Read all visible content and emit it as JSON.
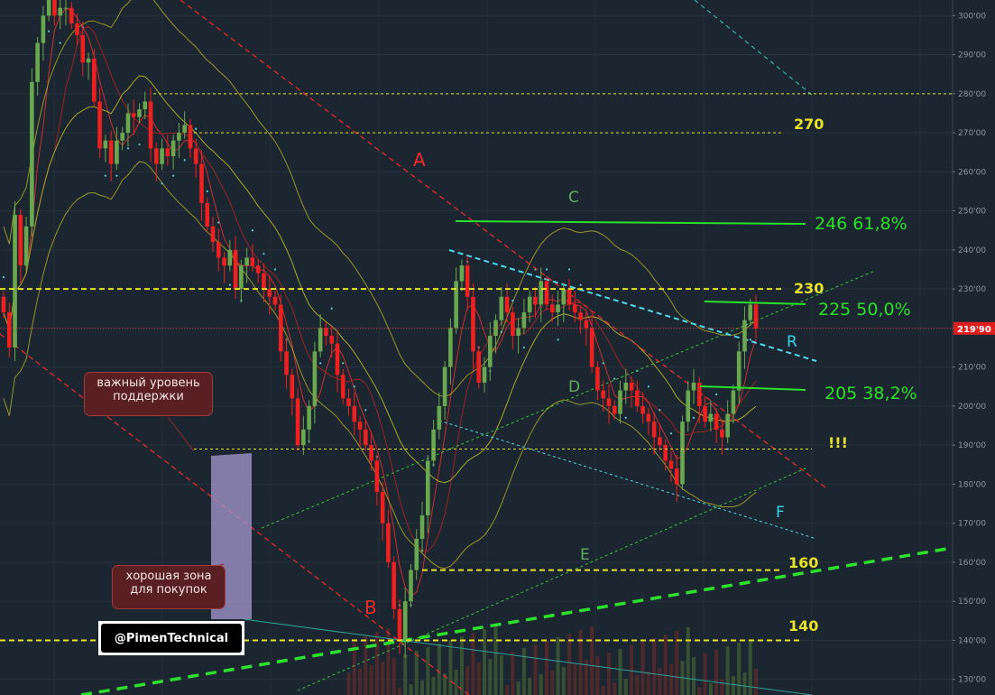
{
  "chart_data": {
    "type": "candlestick",
    "ylim": [
      126,
      304
    ],
    "y_ticks": [
      "130'00",
      "140'00",
      "150'00",
      "160'00",
      "170'00",
      "180'00",
      "190'00",
      "200'00",
      "210'00",
      "220'00",
      "230'00",
      "240'00",
      "250'00",
      "260'00",
      "270'00",
      "280'00",
      "290'00",
      "300'00"
    ],
    "current_price_label": "219'90",
    "current_price": 219.9,
    "candles_close": [
      224,
      215,
      249,
      236,
      246,
      283,
      293,
      300,
      305,
      300,
      302,
      302,
      298,
      295,
      288,
      289,
      278,
      266,
      268,
      262,
      268,
      270,
      275,
      274,
      276,
      278,
      266,
      262,
      266,
      264,
      268,
      270,
      272,
      266,
      262,
      252,
      246,
      242,
      238,
      236,
      240,
      230,
      236,
      238,
      236,
      234,
      230,
      228,
      226,
      214,
      208,
      202,
      190,
      194,
      200,
      214,
      220,
      218,
      216,
      208,
      202,
      200,
      196,
      194,
      190,
      186,
      178,
      170,
      160,
      148,
      140,
      150,
      158,
      166,
      172,
      186,
      194,
      200,
      210,
      220,
      232,
      236,
      228,
      214,
      206,
      210,
      218,
      222,
      228,
      224,
      218,
      220,
      224,
      228,
      226,
      232,
      226,
      224,
      226,
      230,
      226,
      224,
      222,
      220,
      210,
      204,
      202,
      200,
      198,
      204,
      206,
      204,
      200,
      198,
      196,
      192,
      190,
      186,
      184,
      180,
      196,
      204,
      206,
      200,
      196,
      198,
      194,
      192,
      198,
      204,
      214,
      222,
      226,
      219.9
    ],
    "horizontal_levels": [
      {
        "value": 280,
        "label": ""
      },
      {
        "value": 270,
        "label": "270"
      },
      {
        "value": 230,
        "label": "230"
      },
      {
        "value": 189,
        "label": "!!!"
      },
      {
        "value": 158,
        "label": "160"
      },
      {
        "value": 140,
        "label": "140"
      }
    ],
    "fibonacci_levels": [
      {
        "value": 246,
        "label": "246  61,8%"
      },
      {
        "value": 225,
        "label": "225  50,0%"
      },
      {
        "value": 205,
        "label": "205  38,2%"
      }
    ],
    "pattern_labels": [
      "A",
      "B",
      "C",
      "D",
      "E",
      "R",
      "F"
    ],
    "annotations": {
      "support_note": "важный уровень поддержки",
      "buy_zone_note": "хорошая зона для покупок"
    },
    "watermark": "@PimenTechnical",
    "colors": {
      "background": "#1c2630",
      "up_candle": "#6aa84f",
      "down_candle": "#ee2020",
      "level_line": "#e8e22a",
      "fib_line": "#29e02a",
      "channel_red": "#e02a2a",
      "channel_green": "#3ac43a",
      "trend_cyan": "#4fd8ea",
      "price_line": "#d83a3a"
    }
  }
}
